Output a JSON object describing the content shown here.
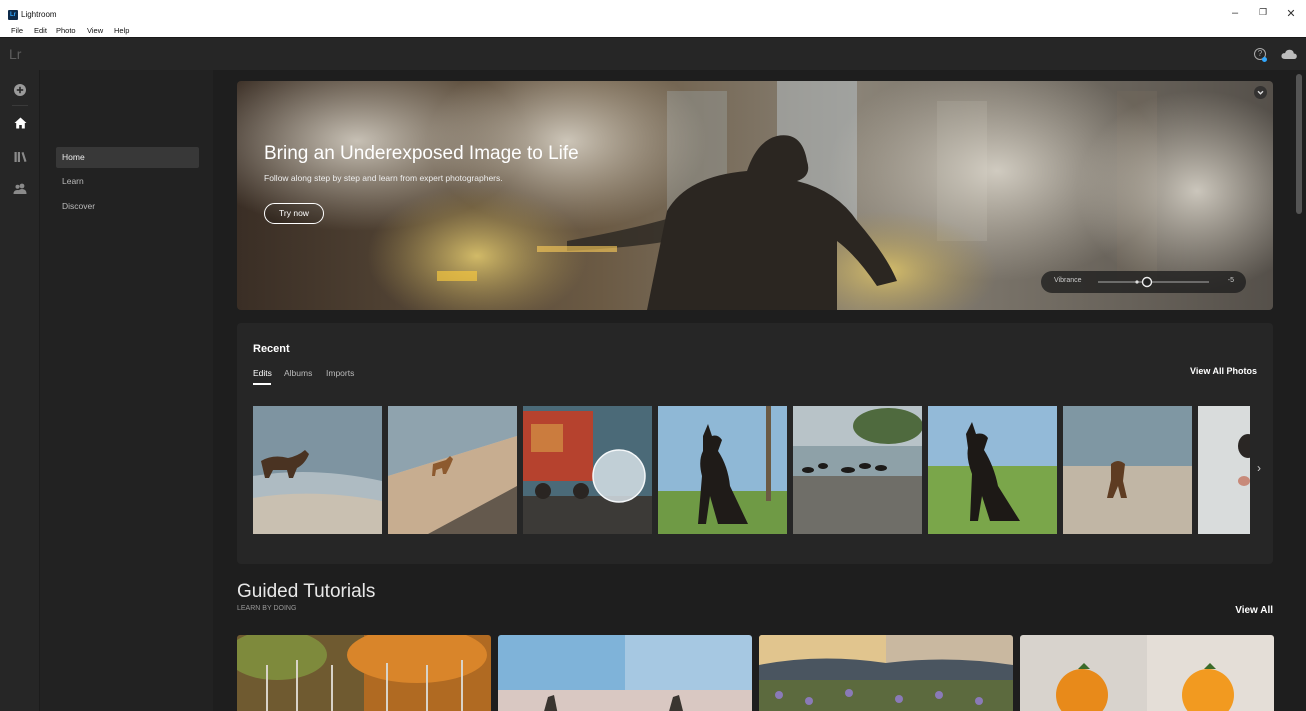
{
  "window": {
    "title": "Lightroom",
    "logo_text": "Lr",
    "menu": [
      "File",
      "Edit",
      "Photo",
      "View",
      "Help"
    ],
    "controls": {
      "minimize": "–",
      "restore": "❐",
      "close": "✕"
    }
  },
  "appbar": {
    "logo": "Lr",
    "help_glyph": "?"
  },
  "rail": {
    "icons": [
      "add-icon",
      "home-icon",
      "library-icon",
      "people-icon"
    ],
    "active": "home-icon"
  },
  "subnav": {
    "items": [
      "Home",
      "Learn",
      "Discover"
    ],
    "active": "Home"
  },
  "hero": {
    "title": "Bring an Underexposed Image to Life",
    "subtitle": "Follow along step by step and learn from expert photographers.",
    "button": "Try now",
    "slider": {
      "label": "Vibrance",
      "value": "-5"
    }
  },
  "recent": {
    "title": "Recent",
    "tabs": [
      "Edits",
      "Albums",
      "Imports"
    ],
    "active_tab": "Edits",
    "view_all": "View All Photos",
    "next": "›"
  },
  "tutorials": {
    "title": "Guided Tutorials",
    "subtitle": "LEARN BY DOING",
    "view_all": "View All"
  },
  "colors": {
    "accent": "#31a8ff",
    "panel": "#262626",
    "background": "#1e1e1e"
  }
}
